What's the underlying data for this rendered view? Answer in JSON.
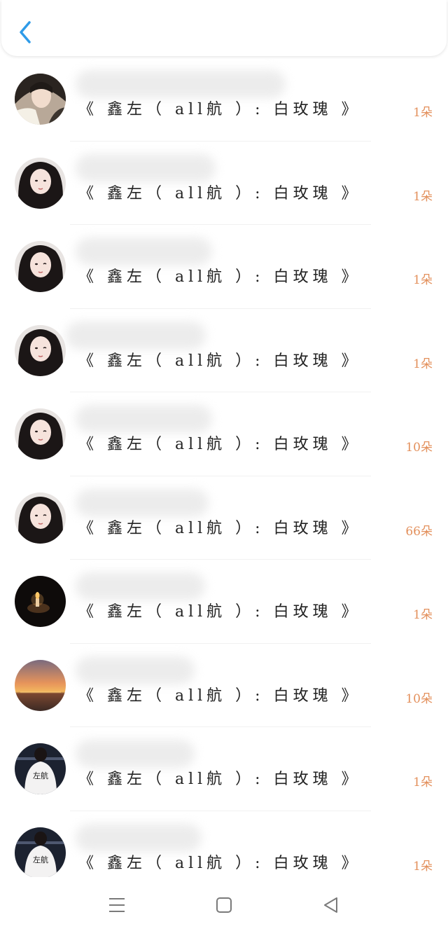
{
  "header": {
    "back_icon": "chevron-left-icon",
    "accent_color": "#2f9be8"
  },
  "list": {
    "items": [
      {
        "title": "《 鑫左（ all航 ）: 白玫瑰 》",
        "count": "1朵",
        "avatar": "girl-white-top"
      },
      {
        "title": "《 鑫左（ all航 ）: 白玫瑰 》",
        "count": "1朵",
        "avatar": "girl-dark-hair"
      },
      {
        "title": "《 鑫左（ all航 ）: 白玫瑰 》",
        "count": "1朵",
        "avatar": "girl-dark-hair"
      },
      {
        "title": "《 鑫左（ all航 ）: 白玫瑰 》",
        "count": "1朵",
        "avatar": "girl-dark-hair"
      },
      {
        "title": "《 鑫左（ all航 ）: 白玫瑰 》",
        "count": "10朵",
        "avatar": "girl-dark-hair"
      },
      {
        "title": "《 鑫左（ all航 ）: 白玫瑰 》",
        "count": "66朵",
        "avatar": "girl-dark-hair"
      },
      {
        "title": "《 鑫左（ all航 ）: 白玫瑰 》",
        "count": "1朵",
        "avatar": "candle-dark"
      },
      {
        "title": "《 鑫左（ all航 ）: 白玫瑰 》",
        "count": "10朵",
        "avatar": "sunset"
      },
      {
        "title": "《 鑫左（ all航 ）: 白玫瑰 》",
        "count": "1朵",
        "avatar": "jersey-back"
      },
      {
        "title": "《 鑫左（ all航 ）: 白玫瑰 》",
        "count": "1朵",
        "avatar": "jersey-back"
      }
    ],
    "count_color": "#e3905c"
  },
  "jersey_text": "左航",
  "navbar": {
    "menu_icon": "menu-icon",
    "home_icon": "home-square-icon",
    "back_icon": "back-triangle-icon"
  }
}
